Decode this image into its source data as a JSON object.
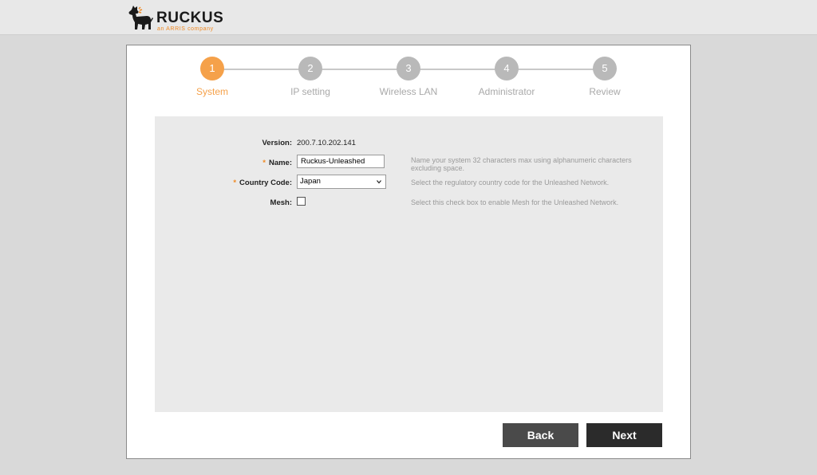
{
  "header": {
    "brand": "RUCKUS",
    "tagline": "an ARRIS company",
    "logo_icon": "dog-logo-icon",
    "accent_color": "#f08a24"
  },
  "wizard": {
    "steps": [
      {
        "number": "1",
        "label": "System",
        "active": true
      },
      {
        "number": "2",
        "label": "IP setting",
        "active": false
      },
      {
        "number": "3",
        "label": "Wireless LAN",
        "active": false
      },
      {
        "number": "4",
        "label": "Administrator",
        "active": false
      },
      {
        "number": "5",
        "label": "Review",
        "active": false
      }
    ],
    "active_color": "#f5a14a",
    "inactive_color": "#b9b9b9"
  },
  "form": {
    "version": {
      "label": "Version:",
      "value": "200.7.10.202.141"
    },
    "name": {
      "required_mark": "*",
      "label": "Name:",
      "value": "Ruckus-Unleashed",
      "hint": "Name your system 32 characters max using alphanumeric characters excluding space."
    },
    "country": {
      "required_mark": "*",
      "label": "Country Code:",
      "value": "Japan",
      "hint": "Select the regulatory country code for the Unleashed Network."
    },
    "mesh": {
      "label": "Mesh:",
      "checked": false,
      "hint": "Select this check box to enable Mesh for the Unleashed Network."
    }
  },
  "buttons": {
    "back": "Back",
    "next": "Next"
  }
}
